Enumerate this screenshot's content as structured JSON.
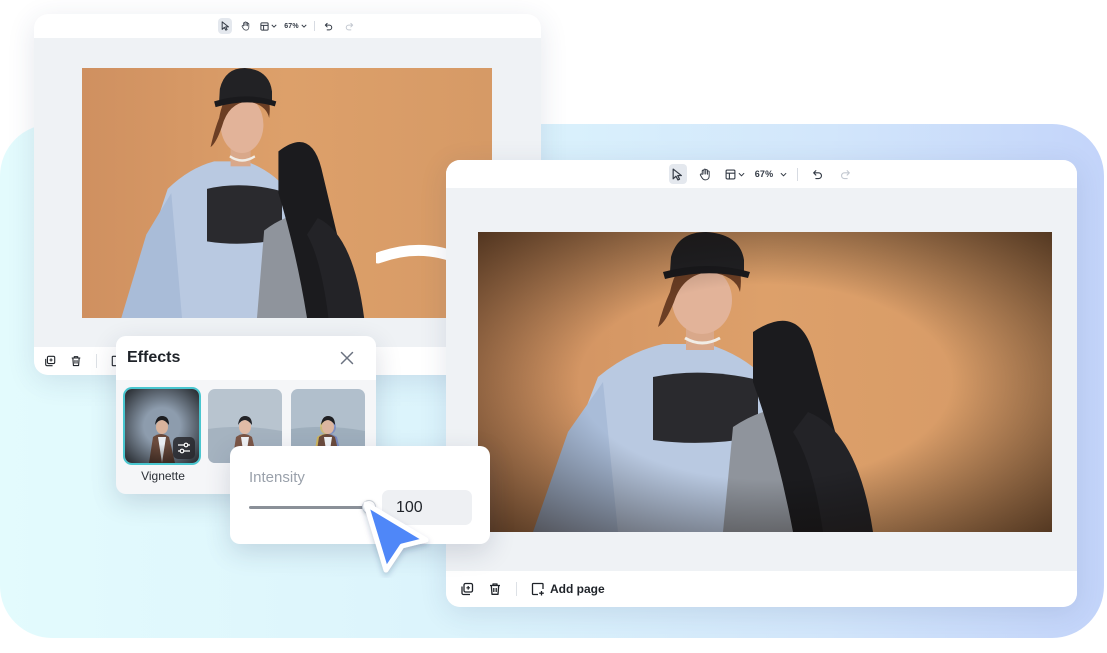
{
  "toolbar": {
    "zoom": "67%",
    "icons": [
      "select-arrow-icon",
      "hand-icon",
      "layout-icon",
      "chevron-down-icon",
      "undo-icon",
      "redo-icon"
    ]
  },
  "bottombar": {
    "add_page_label": "Add page",
    "icons": [
      "duplicate-page-icon",
      "trash-icon",
      "add-page-icon"
    ]
  },
  "effects_panel": {
    "title": "Effects",
    "selected_label": "Vignette",
    "icons": [
      "close-icon",
      "sliders-icon"
    ]
  },
  "intensity": {
    "label": "Intensity",
    "value": "100",
    "slider_fraction": 1.0
  },
  "colors": {
    "accent": "#4f87f8",
    "selection": "#48c6cf",
    "photo_background": "#d89e66"
  }
}
